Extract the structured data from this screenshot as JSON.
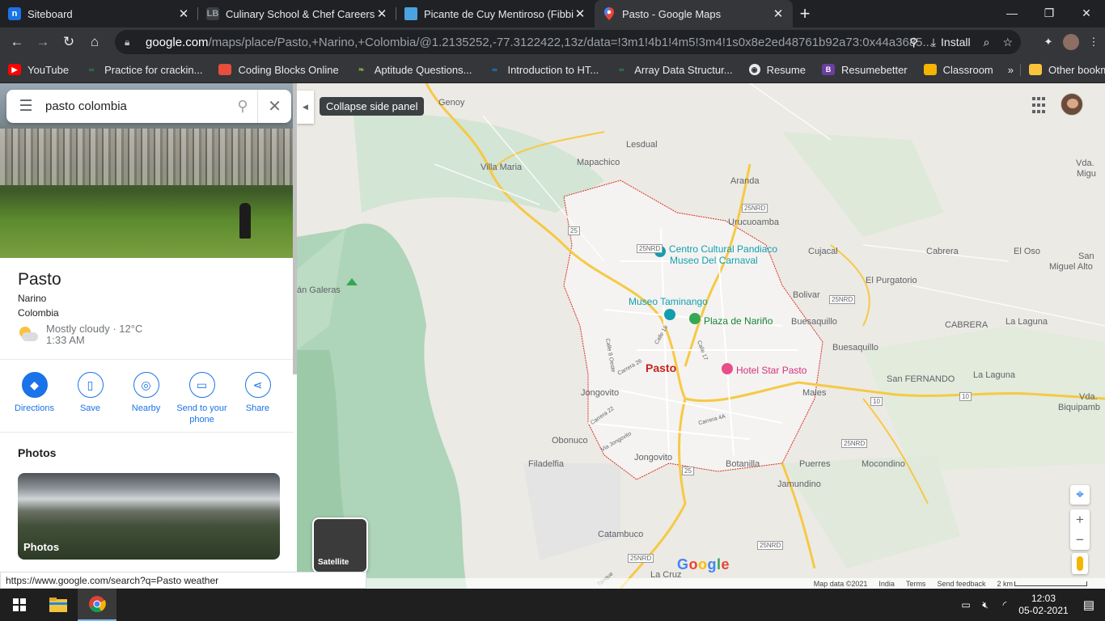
{
  "browser": {
    "tabs": [
      {
        "title": "Siteboard",
        "icon": "n",
        "color": "#1a73e8"
      },
      {
        "title": "Culinary School & Chef Careers |",
        "icon": "LB",
        "color": "#5f6368"
      },
      {
        "title": "Picante de Cuy Mentiroso (Fibbin",
        "icon": "",
        "color": "#4285f4"
      },
      {
        "title": "Pasto - Google Maps",
        "icon": "",
        "color": "#34a853"
      }
    ],
    "url_domain": "google.com",
    "url_path": "/maps/place/Pasto,+Narino,+Colombia/@1.2135252,-77.3122422,13z/data=!3m1!4b1!4m5!3m4!1s0x8e2ed48761b92a73:0x44a3685...",
    "install_label": "Install",
    "bookmarks": [
      {
        "label": "YouTube",
        "color": "#ff0000"
      },
      {
        "label": "Practice for crackin...",
        "color": "#2f8d46"
      },
      {
        "label": "Coding Blocks Online",
        "color": "#e84e3b"
      },
      {
        "label": "Aptitude Questions...",
        "color": "#4caf50"
      },
      {
        "label": "Introduction to HT...",
        "color": "#1e88e5"
      },
      {
        "label": "Array Data Structur...",
        "color": "#2f8d46"
      },
      {
        "label": "Resume",
        "color": "#e8eaed"
      },
      {
        "label": "Resumebetter",
        "color": "#6b3fa0"
      },
      {
        "label": "Classroom",
        "color": "#f4b400"
      }
    ],
    "other_bookmarks": "Other bookmarks",
    "more_bookmarks": "»"
  },
  "sidebar": {
    "search_value": "pasto colombia",
    "place_name": "Pasto",
    "region": "Narino",
    "country": "Colombia",
    "weather": "Mostly cloudy · 12°C",
    "weather_time": "1:33 AM",
    "actions": [
      {
        "label": "Directions",
        "icon": "directions-icon"
      },
      {
        "label": "Save",
        "icon": "bookmark-icon"
      },
      {
        "label": "Nearby",
        "icon": "nearby-icon"
      },
      {
        "label": "Send to your phone",
        "icon": "send-to-phone-icon"
      },
      {
        "label": "Share",
        "icon": "share-icon"
      }
    ],
    "photos_heading": "Photos",
    "photo_label": "Photos"
  },
  "map": {
    "collapse_tooltip": "Collapse side panel",
    "satellite_label": "Satellite",
    "google_logo": "Google",
    "attribution": [
      "Map data ©2021",
      "India",
      "Terms",
      "Send feedback",
      "2 km"
    ],
    "labels": {
      "genoy": "Genoy",
      "lesdual": "Lesdual",
      "villa_maria": "Villa Maria",
      "mapachico": "Mapachico",
      "aranda": "Aranda",
      "urucuoamba": "Urucuoamba",
      "cujacal": "Cujacal",
      "cabrera": "Cabrera",
      "el_oso": "El Oso",
      "el_purgatorio": "El Purgatorio",
      "bolivar": "Bolivar",
      "buesaquillo": "Buesaquillo",
      "cabrera_upper": "CABRERA",
      "la_laguna": "La Laguna",
      "buesaquillo2": "Buesaquillo",
      "san_fernando": "San FERNANDO",
      "la_laguna2": "La Laguna",
      "males": "Males",
      "jongovito": "Jongovito",
      "obonuco": "Obonuco",
      "jongovito2": "Jongovito",
      "botanilla": "Botanilla",
      "puerres": "Puerres",
      "mocondino": "Mocondino",
      "filadelfia": "Filadelfia",
      "jamundino": "Jamundino",
      "catambuco": "Catambuco",
      "la_cruz": "La Cruz",
      "galeras": "án Galeras",
      "pasto": "Pasto",
      "vda": "Vda.",
      "migu": "Migu",
      "san_miguel": "San",
      "miguel_alto": "Miguel Alto",
      "vda2": "Vda.",
      "biquipamba": "Biquipamb"
    },
    "pois": [
      {
        "name": "Centro Cultural Pandiaco",
        "color": "#129eaf"
      },
      {
        "name": "Museo Del Carnaval",
        "color": "#129eaf"
      },
      {
        "name": "Museo Taminango",
        "color": "#129eaf"
      },
      {
        "name": "Plaza de Nariño",
        "color": "#34a853"
      },
      {
        "name": "Hotel Star Pasto",
        "color": "#ea4c89"
      }
    ],
    "roads": [
      "25NRD",
      "25",
      "25NRD",
      "10",
      "10",
      "25NRD",
      "25",
      "25NRD",
      "25NRD",
      "25NRD"
    ],
    "streets": [
      "Calle 16",
      "Calle 17",
      "Carrera 26",
      "Calle 8 Oeste",
      "Carrera 22",
      "Via Jongovito",
      "Carrera 4A",
      "Tanque"
    ]
  },
  "status_url": "https://www.google.com/search?q=Pasto weather",
  "taskbar": {
    "time": "12:03",
    "date": "05-02-2021"
  }
}
